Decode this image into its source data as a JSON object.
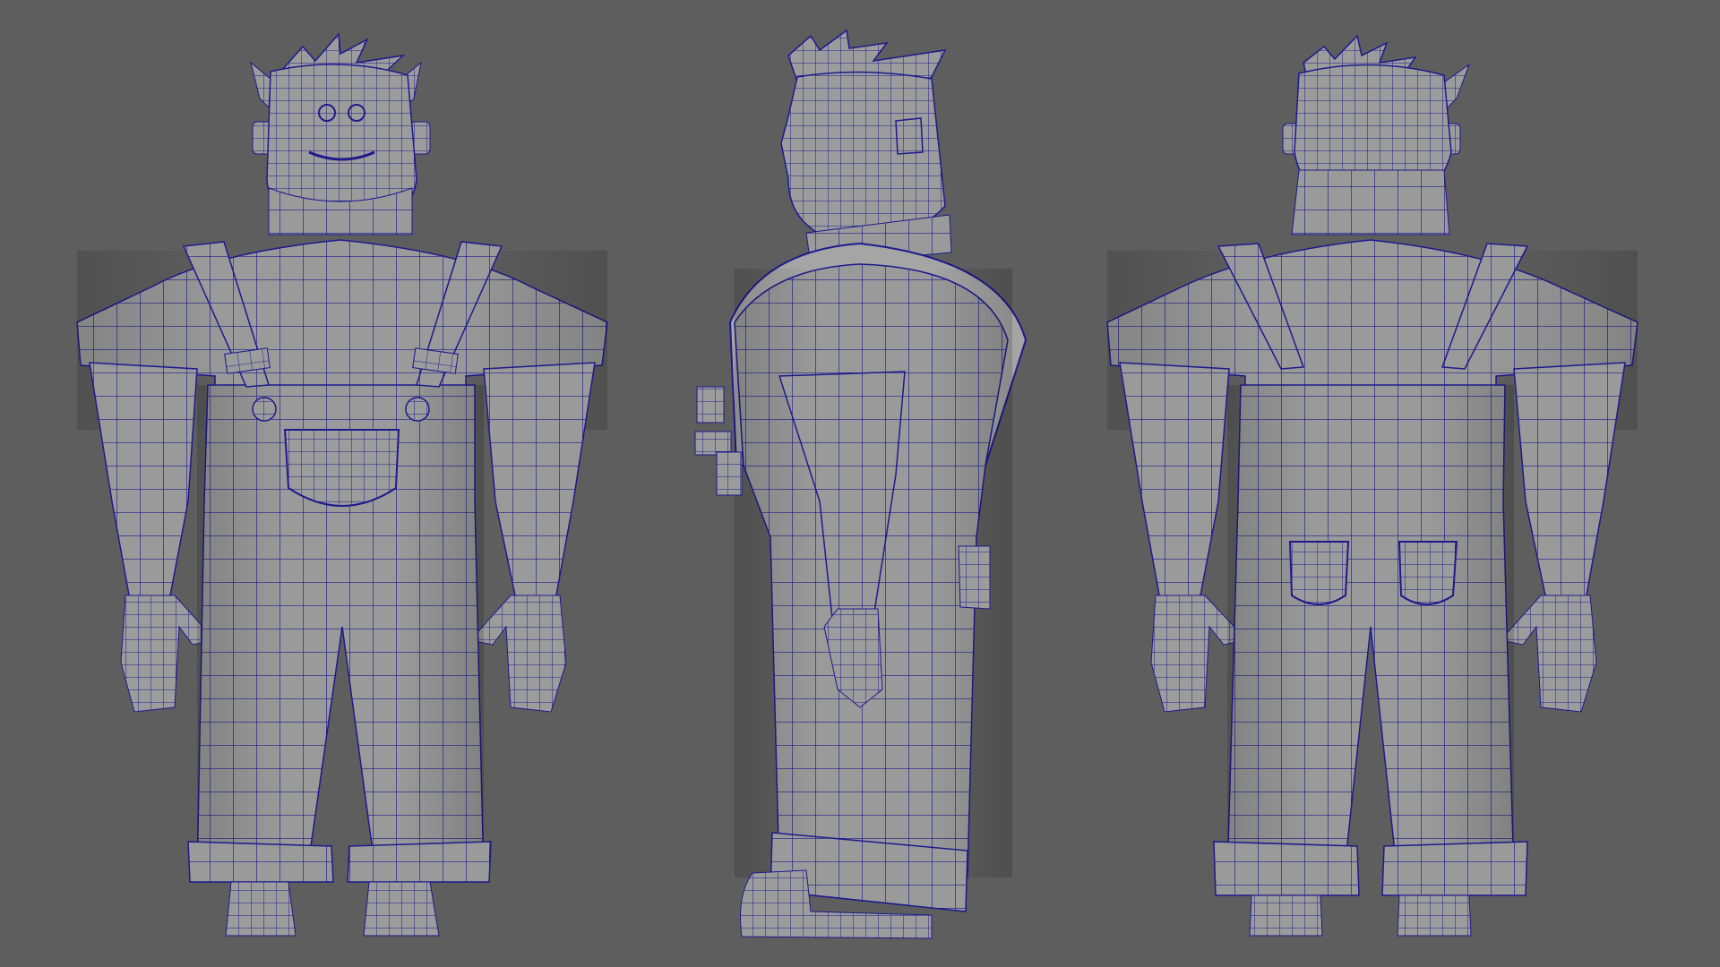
{
  "scene": {
    "background_color": "#5e5e5e",
    "mesh_fill": "#9a9a9a",
    "mesh_shade": "#7c7c7c",
    "mesh_highlight": "#b4b4b4",
    "wire_color": "#1e1a8c",
    "views": [
      {
        "id": "front",
        "label": ""
      },
      {
        "id": "side",
        "label": ""
      },
      {
        "id": "back",
        "label": ""
      }
    ]
  }
}
